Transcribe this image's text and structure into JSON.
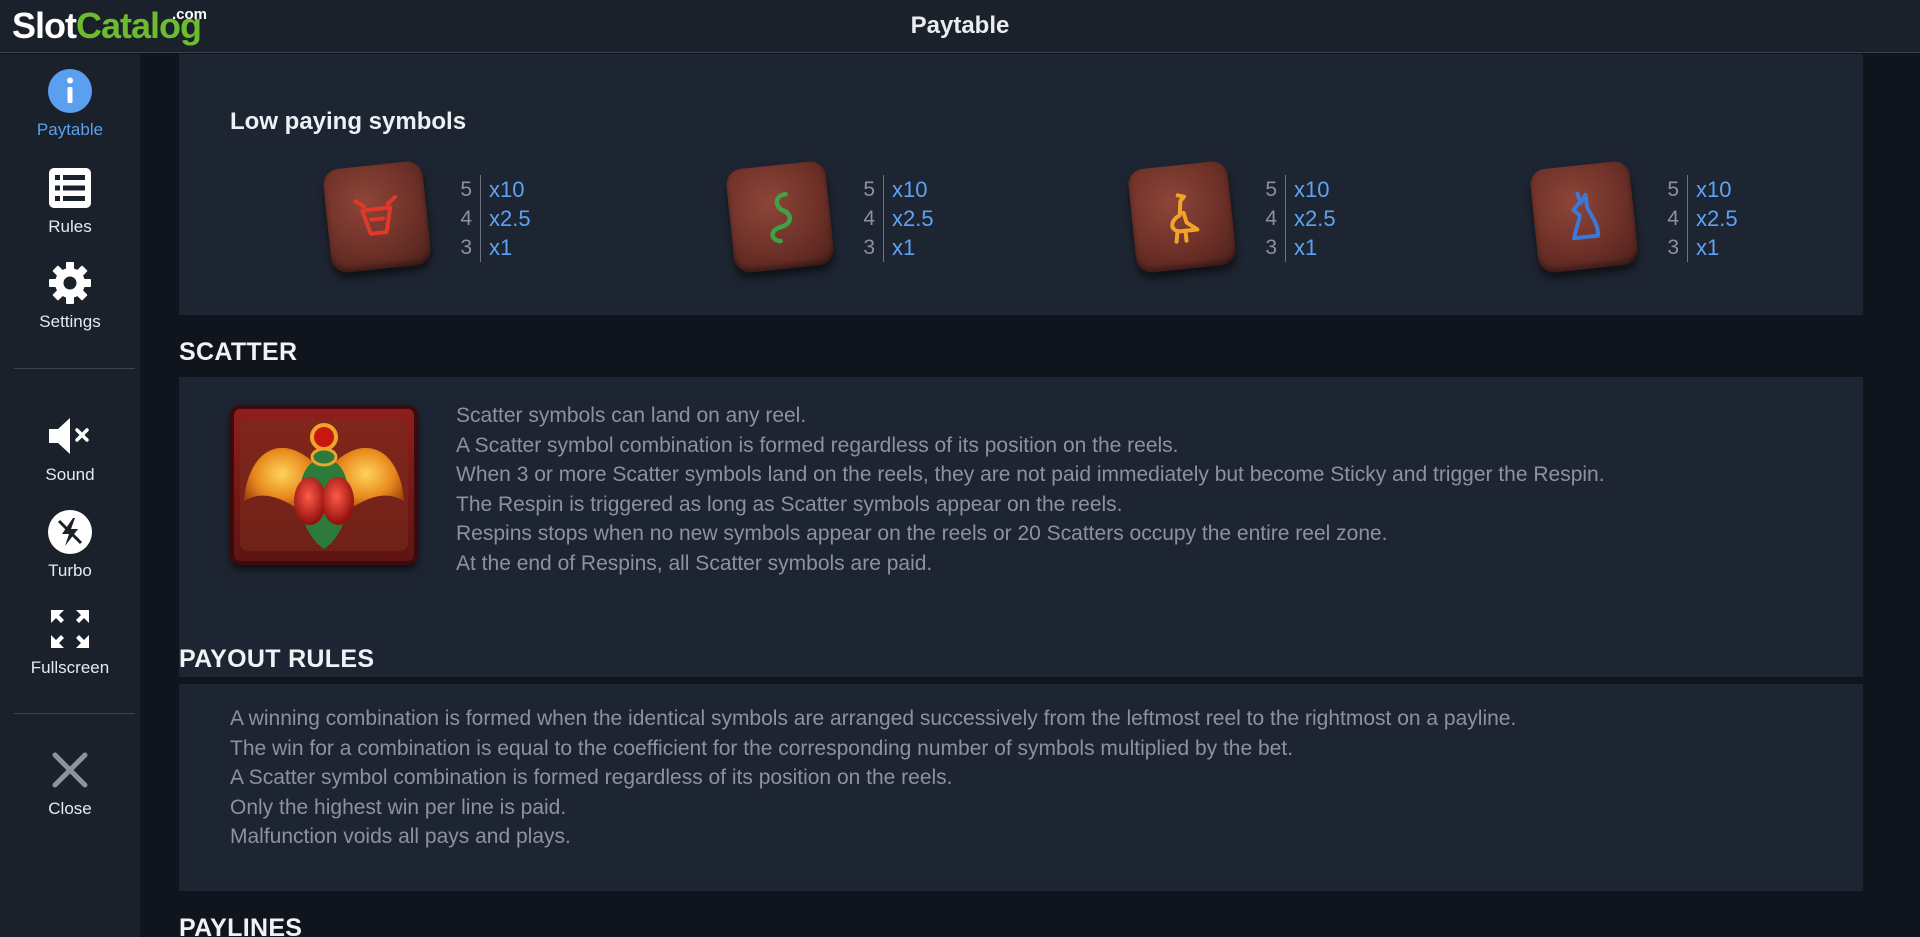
{
  "header": {
    "title": "Paytable"
  },
  "logo": {
    "slot": "Slot",
    "catalog": "Catalog",
    "com": ".com"
  },
  "sidebar": {
    "items": [
      {
        "label": "Paytable",
        "icon": "info-icon",
        "active": true
      },
      {
        "label": "Rules",
        "icon": "list-icon"
      },
      {
        "label": "Settings",
        "icon": "gear-icon"
      },
      {
        "label": "Sound",
        "icon": "speaker-muted-icon"
      },
      {
        "label": "Turbo",
        "icon": "turbo-icon"
      },
      {
        "label": "Fullscreen",
        "icon": "fullscreen-icon"
      },
      {
        "label": "Close",
        "icon": "close-icon"
      }
    ]
  },
  "low_paying": {
    "title": "Low paying symbols",
    "symbols": [
      {
        "glyph": "ox-head-glyph",
        "color": "#e0382a",
        "pays": [
          {
            "count": "5",
            "mult": "x10"
          },
          {
            "count": "4",
            "mult": "x2.5"
          },
          {
            "count": "3",
            "mult": "x1"
          }
        ]
      },
      {
        "glyph": "snake-glyph",
        "color": "#3ea347",
        "pays": [
          {
            "count": "5",
            "mult": "x10"
          },
          {
            "count": "4",
            "mult": "x2.5"
          },
          {
            "count": "3",
            "mult": "x1"
          }
        ]
      },
      {
        "glyph": "bird-glyph",
        "color": "#f0a52a",
        "pays": [
          {
            "count": "5",
            "mult": "x10"
          },
          {
            "count": "4",
            "mult": "x2.5"
          },
          {
            "count": "3",
            "mult": "x1"
          }
        ]
      },
      {
        "glyph": "jackal-glyph",
        "color": "#3d77d8",
        "pays": [
          {
            "count": "5",
            "mult": "x10"
          },
          {
            "count": "4",
            "mult": "x2.5"
          },
          {
            "count": "3",
            "mult": "x1"
          }
        ]
      }
    ]
  },
  "scatter": {
    "title": "SCATTER",
    "lines": [
      "Scatter symbols can land on any reel.",
      "A Scatter symbol combination is formed regardless of its position on the reels.",
      "When 3 or more Scatter symbols land on the reels, they are not paid immediately but become Sticky and trigger the Respin.",
      "The Respin is triggered as long as Scatter symbols appear on the reels.",
      "Respins stops when no new symbols appear on the reels or 20 Scatters occupy the entire reel zone.",
      "At the end of Respins, all Scatter symbols are paid."
    ]
  },
  "payout_rules": {
    "title": "PAYOUT RULES",
    "lines": [
      "A winning combination is formed when the identical symbols are arranged successively from the leftmost reel to the rightmost on a payline.",
      "The win for a combination is equal to the coefficient for the corresponding number of symbols multiplied by the bet.",
      "A Scatter symbol combination is formed regardless of its position on the reels.",
      "Only the highest win per line is paid.",
      "Malfunction voids all pays and plays."
    ]
  },
  "paylines": {
    "title": "PAYLINES"
  },
  "colors": {
    "accent": "#5b9ff0",
    "pay_value": "#5ea3f2",
    "panel": "#1e2532",
    "background": "#10141c"
  }
}
